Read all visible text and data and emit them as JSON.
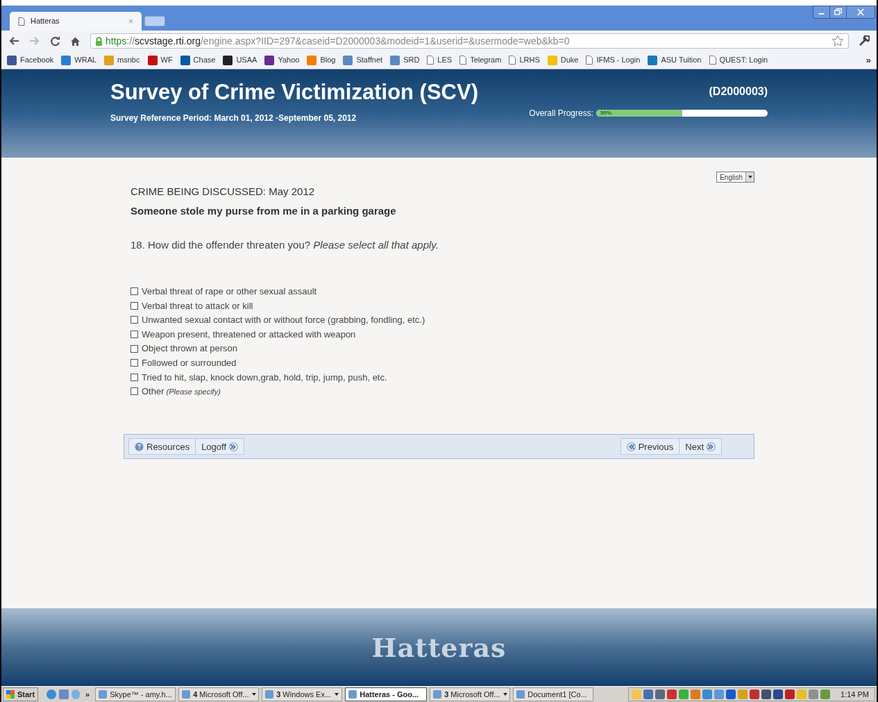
{
  "browser": {
    "tabs": [
      {
        "title": "Hatteras",
        "close": "×",
        "selected": true
      }
    ],
    "url": {
      "scheme": "https",
      "separator": "://",
      "host": "scvstage.rti.org",
      "path": "/engine.aspx?IID=297&caseid=D2000003&modeid=1&userid=&usermode=web&kb=0"
    },
    "bookmarks": [
      {
        "label": "Facebook"
      },
      {
        "label": "WRAL"
      },
      {
        "label": "msnbc"
      },
      {
        "label": "WF"
      },
      {
        "label": "Chase"
      },
      {
        "label": "USAA"
      },
      {
        "label": "Yahoo"
      },
      {
        "label": "Blog"
      },
      {
        "label": "Staffnet"
      },
      {
        "label": "SRD"
      },
      {
        "label": "LES"
      },
      {
        "label": "Telegram"
      },
      {
        "label": "LRHS"
      },
      {
        "label": "Duke"
      },
      {
        "label": "IFMS - Login"
      },
      {
        "label": "ASU Tuition"
      },
      {
        "label": "QUEST: Login"
      }
    ],
    "bookmarks_overflow": "»"
  },
  "header": {
    "title": "Survey of Crime Victimization (SCV)",
    "reference_period": "Survey Reference Period: March 01, 2012 -September 05, 2012",
    "case_id": "(D2000003)",
    "progress": {
      "label": "Overall Progress:",
      "level": 0.5,
      "reading": "50%"
    }
  },
  "language_select": {
    "value": "English"
  },
  "crime": {
    "heading": "CRIME BEING DISCUSSED: May 2012",
    "description": "Someone stole my purse from me in a parking garage"
  },
  "question": {
    "number": "18.",
    "text": "How did the offender threaten you?",
    "instruction": "Please select all that apply."
  },
  "options": [
    {
      "label": "Verbal threat of rape or other sexual assault",
      "checked": false
    },
    {
      "label": "Verbal threat to attack or kill",
      "checked": false
    },
    {
      "label": "Unwanted sexual contact with or without force (grabbing, fondling, etc.)",
      "checked": false
    },
    {
      "label": "Weapon present, threatened or attacked with weapon",
      "checked": false
    },
    {
      "label": "Object thrown at person",
      "checked": false
    },
    {
      "label": "Followed or surrounded",
      "checked": false
    },
    {
      "label": "Tried to hit, slap, knock down,grab, hold, trip, jump, push, etc.",
      "checked": false
    },
    {
      "label": "Other",
      "note": "(Please specify)",
      "checked": false
    }
  ],
  "nav": {
    "left": [
      {
        "label": "Resources",
        "kind": "help"
      },
      {
        "label": "Logoff",
        "kind": "forward"
      }
    ],
    "right": [
      {
        "label": "Previous",
        "kind": "back"
      },
      {
        "label": "Next",
        "kind": "forward"
      }
    ]
  },
  "footer": {
    "logo": "Hatteras"
  },
  "taskbar": {
    "start": "Start",
    "quick_launch_overflow": "»",
    "tasks": [
      {
        "label": "Skype™ - amy.h...",
        "selected": false,
        "dropdown": false
      },
      {
        "label": "**4** Microsoft Off...",
        "selected": false,
        "dropdown": true
      },
      {
        "label": "**3** Windows Ex...",
        "selected": false,
        "dropdown": true
      },
      {
        "label": "Hatteras - Goo...",
        "selected": true,
        "dropdown": false
      },
      {
        "label": "**3** Microsoft Off...",
        "selected": false,
        "dropdown": true
      },
      {
        "label": "Document1 [Co...",
        "selected": false,
        "dropdown": false
      }
    ],
    "clock": "1:14 PM"
  }
}
